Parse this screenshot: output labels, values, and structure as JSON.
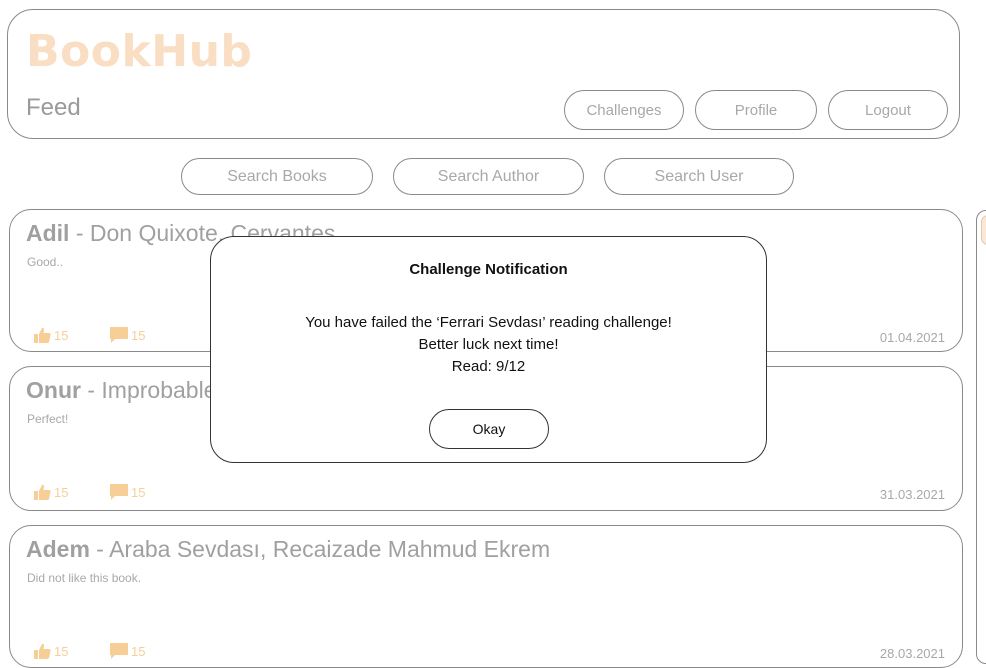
{
  "header": {
    "brand": "BookHub",
    "page_title": "Feed",
    "nav": {
      "challenges": "Challenges",
      "profile": "Profile",
      "logout": "Logout"
    }
  },
  "search": {
    "books": "Search Books",
    "author": "Search Author",
    "user": "Search User"
  },
  "posts": [
    {
      "user": "Adil",
      "sep": " - ",
      "book": "Don Quixote, Cervantes",
      "comment": "Good..",
      "likes": "15",
      "comments": "15",
      "date": "01.04.2021"
    },
    {
      "user": "Onur",
      "sep": " - ",
      "book": "Improbable, Adam Fawer",
      "comment": "Perfect!",
      "likes": "15",
      "comments": "15",
      "date": "31.03.2021"
    },
    {
      "user": "Adem",
      "sep": " - ",
      "book": "Araba Sevdası, Recaizade Mahmud Ekrem",
      "comment": "Did not like this book.",
      "likes": "15",
      "comments": "15",
      "date": "28.03.2021"
    }
  ],
  "modal": {
    "title": "Challenge Notification",
    "line1": "You have failed the ‘Ferrari Sevdası’ reading challenge!",
    "line2": "Better luck next time!",
    "line3": "Read: 9/12",
    "okay": "Okay"
  },
  "colors": {
    "brand": "#f9dec4",
    "accent": "#f7cf96",
    "border": "#8a8a8a"
  },
  "icons": {
    "like": "thumbs-up-icon",
    "comment": "comment-icon"
  }
}
